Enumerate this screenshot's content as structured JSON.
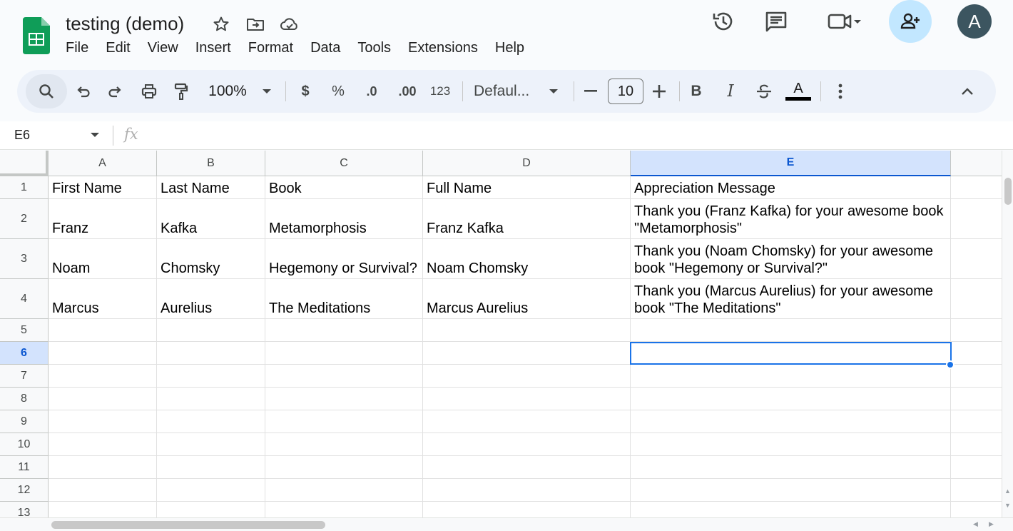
{
  "doc": {
    "title": "testing (demo)"
  },
  "menu": [
    "File",
    "Edit",
    "View",
    "Insert",
    "Format",
    "Data",
    "Tools",
    "Extensions",
    "Help"
  ],
  "avatar_letter": "A",
  "toolbar": {
    "zoom": "100%",
    "currency": "$",
    "percent": "%",
    "dec_decrease": ".0",
    "dec_increase": ".00",
    "number_format": "123",
    "font": "Defaul...",
    "font_size": "10",
    "bold": "B",
    "italic": "I",
    "text_color_letter": "A"
  },
  "formula_bar": {
    "cell_ref": "E6",
    "fx": "fx",
    "value": ""
  },
  "grid": {
    "columns": [
      "A",
      "B",
      "C",
      "D",
      "E"
    ],
    "selected_column": "E",
    "row_numbers": [
      "1",
      "2",
      "3",
      "4",
      "5",
      "6",
      "7",
      "8",
      "9",
      "10",
      "11",
      "12",
      "13"
    ],
    "selected_row": "6",
    "rows": [
      [
        "First Name",
        "Last Name",
        "Book",
        "Full Name",
        "Appreciation Message"
      ],
      [
        "Franz",
        "Kafka",
        "Metamorphosis",
        "Franz Kafka",
        "Thank you (Franz Kafka) for your awesome book \"Metamorphosis\""
      ],
      [
        "Noam",
        "Chomsky",
        "Hegemony or Survival?",
        "Noam Chomsky",
        "Thank you (Noam Chomsky) for your awesome book \"Hegemony or Survival?\""
      ],
      [
        "Marcus",
        "Aurelius",
        "The Meditations",
        "Marcus Aurelius",
        "Thank you (Marcus Aurelius) for your awesome book \"The Meditations\""
      ]
    ]
  },
  "colors": {
    "accent": "#1a73e8",
    "sheets_green": "#0f9d58",
    "share_bg": "#c2e7ff",
    "selected_header": "#d3e3fd"
  }
}
